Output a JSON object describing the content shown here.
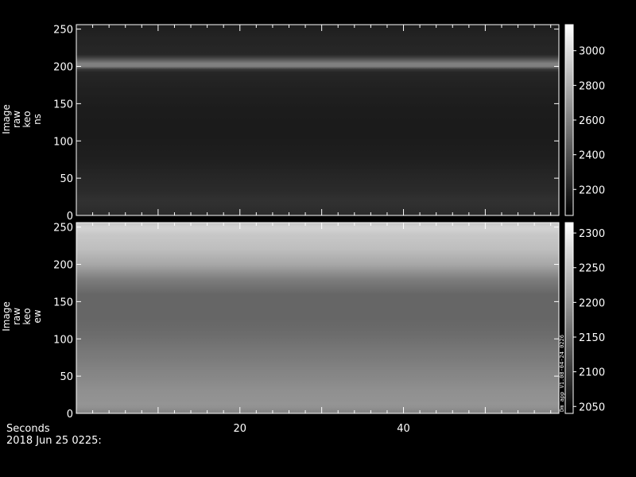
{
  "chart_data": [
    {
      "type": "heatmap",
      "ylabel_lines": [
        "Image",
        "raw",
        "keo",
        "ns"
      ],
      "xlim": [
        0,
        59
      ],
      "ylim": [
        0,
        256
      ],
      "yticks": [
        0,
        50,
        100,
        150,
        200,
        250
      ],
      "colorbar_range": [
        2050,
        3150
      ],
      "colorbar_ticks": [
        2200,
        2400,
        2600,
        2800,
        3000
      ],
      "profile_y": [
        0,
        10,
        20,
        30,
        50,
        80,
        110,
        140,
        170,
        195,
        200,
        202,
        204,
        215,
        240,
        256
      ],
      "profile_value": [
        2230,
        2250,
        2260,
        2240,
        2215,
        2180,
        2165,
        2170,
        2190,
        2215,
        2600,
        3150,
        2600,
        2220,
        2200,
        2180
      ],
      "colormap": "grayscale"
    },
    {
      "type": "heatmap",
      "ylabel_lines": [
        "Image",
        "raw",
        "keo",
        "ew"
      ],
      "xlim": [
        0,
        59
      ],
      "ylim": [
        0,
        256
      ],
      "yticks": [
        0,
        50,
        100,
        150,
        200,
        250
      ],
      "colorbar_range": [
        2040,
        2315
      ],
      "colorbar_ticks": [
        2050,
        2100,
        2150,
        2200,
        2250,
        2300
      ],
      "profile_y": [
        0,
        10,
        30,
        60,
        90,
        110,
        130,
        160,
        180,
        200,
        220,
        240,
        250,
        256
      ],
      "profile_value": [
        2180,
        2200,
        2195,
        2180,
        2165,
        2155,
        2150,
        2150,
        2175,
        2220,
        2245,
        2255,
        2270,
        2250
      ],
      "colormap": "grayscale",
      "side_annotation": "Dm_app_V1.08-04-24_0226"
    }
  ],
  "shared_x_axis": {
    "label": "Seconds",
    "ticks": [
      20,
      40
    ]
  },
  "footer": {
    "date_label": "2018 Jun 25 0225:"
  },
  "colors": {
    "background": "#000000",
    "foreground": "#ffffff"
  }
}
